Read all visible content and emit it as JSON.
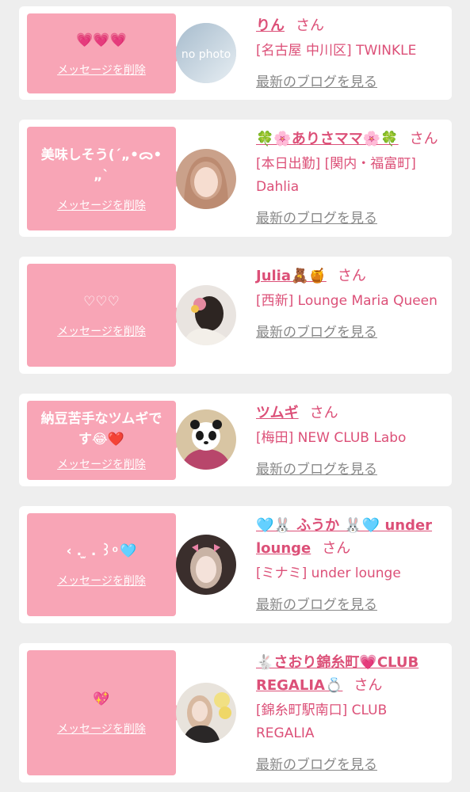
{
  "items": [
    {
      "message": "💗💗💗",
      "delete_label": "メッセージを削除",
      "name": "りん",
      "honorific": "さん",
      "shop": "[名古屋 中川区] TWINKLE",
      "blog_link": "最新のブログを見る",
      "avatar_text": "no photo"
    },
    {
      "message": "美味しそう(´„•ᯅ•„`",
      "delete_label": "メッセージを削除",
      "name": "🍀🌸ありさママ🌸🍀",
      "honorific": "さん",
      "shop": "[本日出勤] [関内・福富町] Dahlia",
      "blog_link": "最新のブログを見る"
    },
    {
      "message": "♡♡♡",
      "delete_label": "メッセージを削除",
      "name": "Julia🧸🍯",
      "honorific": "さん",
      "shop": "[西新] Lounge Maria Queen",
      "blog_link": "最新のブログを見る"
    },
    {
      "message": "納豆苦手なツムギです😂❤️",
      "delete_label": "メッセージを削除",
      "name": "ツムギ",
      "honorific": "さん",
      "shop": "[梅田] NEW CLUB Labo",
      "blog_link": "最新のブログを見る"
    },
    {
      "message": "‹ . ̫ . ꒱ ͦ 🩵",
      "delete_label": "メッセージを削除",
      "name": "🩵🐰 ふうか 🐰🩵 under lounge",
      "honorific": "さん",
      "shop": "[ミナミ] under lounge",
      "blog_link": "最新のブログを見る"
    },
    {
      "message": "💖",
      "delete_label": "メッセージを削除",
      "name": "🐇さおり錦糸町💗CLUB REGALIA💍",
      "honorific": "さん",
      "shop": "[錦糸町駅南口] CLUB REGALIA",
      "blog_link": "最新のブログを見る"
    }
  ],
  "colors": {
    "bubble": "#f8a5b6",
    "accent": "#dc5078",
    "muted": "#888888",
    "background": "#eeeeee"
  }
}
